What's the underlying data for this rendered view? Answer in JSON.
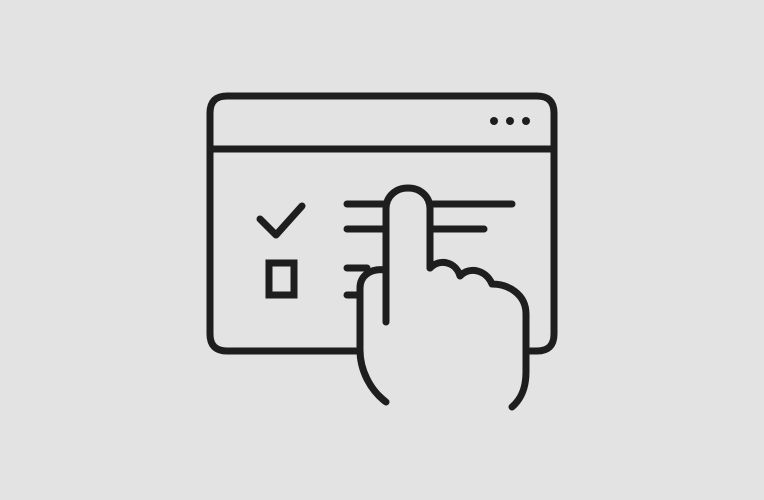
{
  "illustration": {
    "name": "browser-checklist-tap",
    "icons": [
      "browser-window-icon",
      "menu-dots-icon",
      "checkmark-icon",
      "empty-checkbox-icon",
      "text-lines-icon",
      "pointing-hand-icon"
    ]
  },
  "checklist": {
    "items": [
      {
        "state": "checked",
        "icon": "checkmark-icon"
      },
      {
        "state": "unchecked",
        "icon": "empty-checkbox-icon"
      }
    ]
  },
  "colors": {
    "background": "#e3e3e3",
    "stroke": "#1e1e1e"
  }
}
